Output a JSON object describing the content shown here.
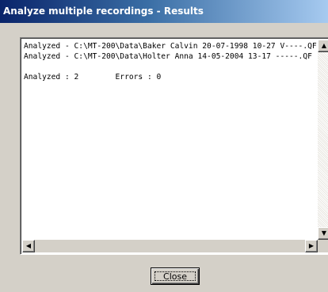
{
  "window": {
    "title": "Analyze multiple recordings - Results"
  },
  "results": {
    "lines": [
      "Analyzed - C:\\MT-200\\Data\\Baker Calvin 20-07-1998 10-27 V----.QF",
      "Analyzed - C:\\MT-200\\Data\\Holter Anna 14-05-2004 13-17 -----.QF",
      "",
      "Analyzed : 2        Errors : 0"
    ]
  },
  "scrollbars": {
    "up_glyph": "▲",
    "down_glyph": "▼",
    "left_glyph": "◀",
    "right_glyph": "▶"
  },
  "buttons": {
    "close_label": "Close"
  },
  "icons": {
    "scroll_up": "arrow-up-icon",
    "scroll_down": "arrow-down-icon",
    "scroll_left": "arrow-left-icon",
    "scroll_right": "arrow-right-icon"
  }
}
